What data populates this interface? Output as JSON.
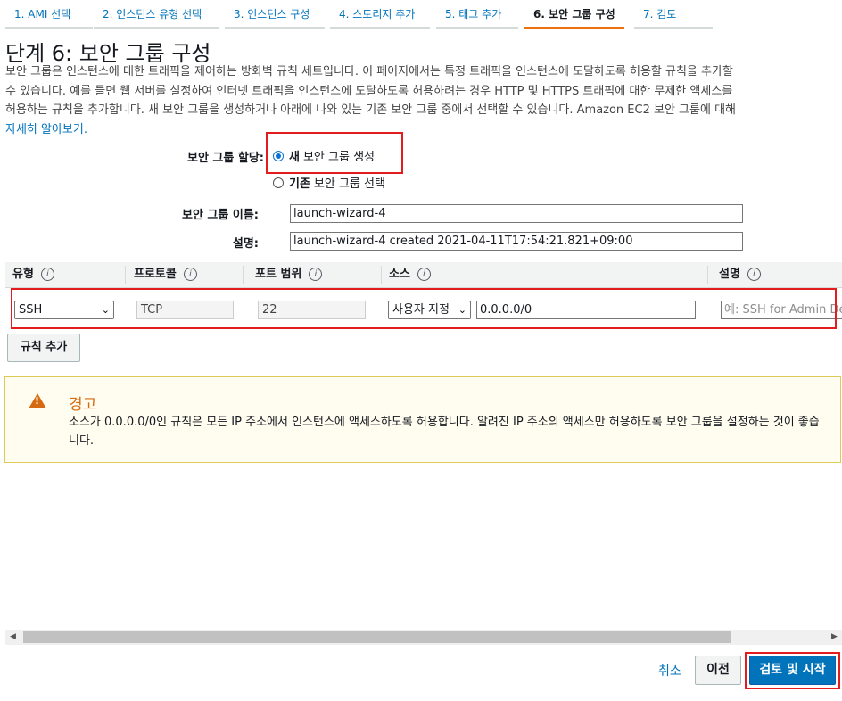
{
  "tabs": [
    {
      "label": "1. AMI 선택"
    },
    {
      "label": "2. 인스턴스 유형 선택"
    },
    {
      "label": "3. 인스턴스 구성"
    },
    {
      "label": "4. 스토리지 추가"
    },
    {
      "label": "5. 태그 추가"
    },
    {
      "label": "6. 보안 그룹 구성"
    },
    {
      "label": "7. 검토"
    }
  ],
  "page": {
    "title": "단계 6: 보안 그룹 구성",
    "description_lines": [
      "보안 그룹은 인스턴스에 대한 트래픽을 제어하는 방화벽 규칙 세트입니다. 이 페이지에서는 특정 트래픽을 인스턴스에 도달하도록 허용할 규칙을 추가할",
      "수 있습니다. 예를 들면 웹 서버를 설정하여 인터넷 트래픽을 인스턴스에 도달하도록 허용하려는 경우 HTTP 및 HTTPS 트래픽에 대한 무제한 액세스를",
      "허용하는 규칙을 추가합니다. 새 보안 그룹을 생성하거나 아래에 나와 있는 기존 보안 그룹 중에서 선택할 수 있습니다. Amazon EC2 보안 그룹에 대해"
    ],
    "learn_more": "자세히 알아보기"
  },
  "assign": {
    "label": "보안 그룹 할당:",
    "option_new_bold": "새",
    "option_new_rest": "보안 그룹 생성",
    "option_existing_bold": "기존",
    "option_existing_rest": "보안 그룹 선택",
    "selected": "new"
  },
  "form": {
    "name_label": "보안 그룹 이름:",
    "name_value": "launch-wizard-4",
    "desc_label": "설명:",
    "desc_value": "launch-wizard-4 created 2021-04-11T17:54:21.821+09:00"
  },
  "table": {
    "headers": [
      "유형",
      "프로토콜",
      "포트 범위",
      "소스",
      "설명"
    ],
    "row": {
      "type": "SSH",
      "protocol": "TCP",
      "port_range": "22",
      "source_select": "사용자 지정",
      "source_cidr": "0.0.0.0/0",
      "description_placeholder": "예: SSH for Admin Desktop"
    }
  },
  "add_rule": "규칙 추가",
  "warning": {
    "title": "경고",
    "text": "소스가 0.0.0.0/0인 규칙은 모든 IP 주소에서 인스턴스에 액세스하도록 허용합니다. 알려진 IP 주소의 액세스만 허용하도록 보안 그룹을 설정하는 것이 좋습니다.",
    "icon": "warning-icon",
    "color": "#d56b11"
  },
  "footer": {
    "cancel": "취소",
    "previous": "이전",
    "review_launch": "검토 및 시작"
  }
}
